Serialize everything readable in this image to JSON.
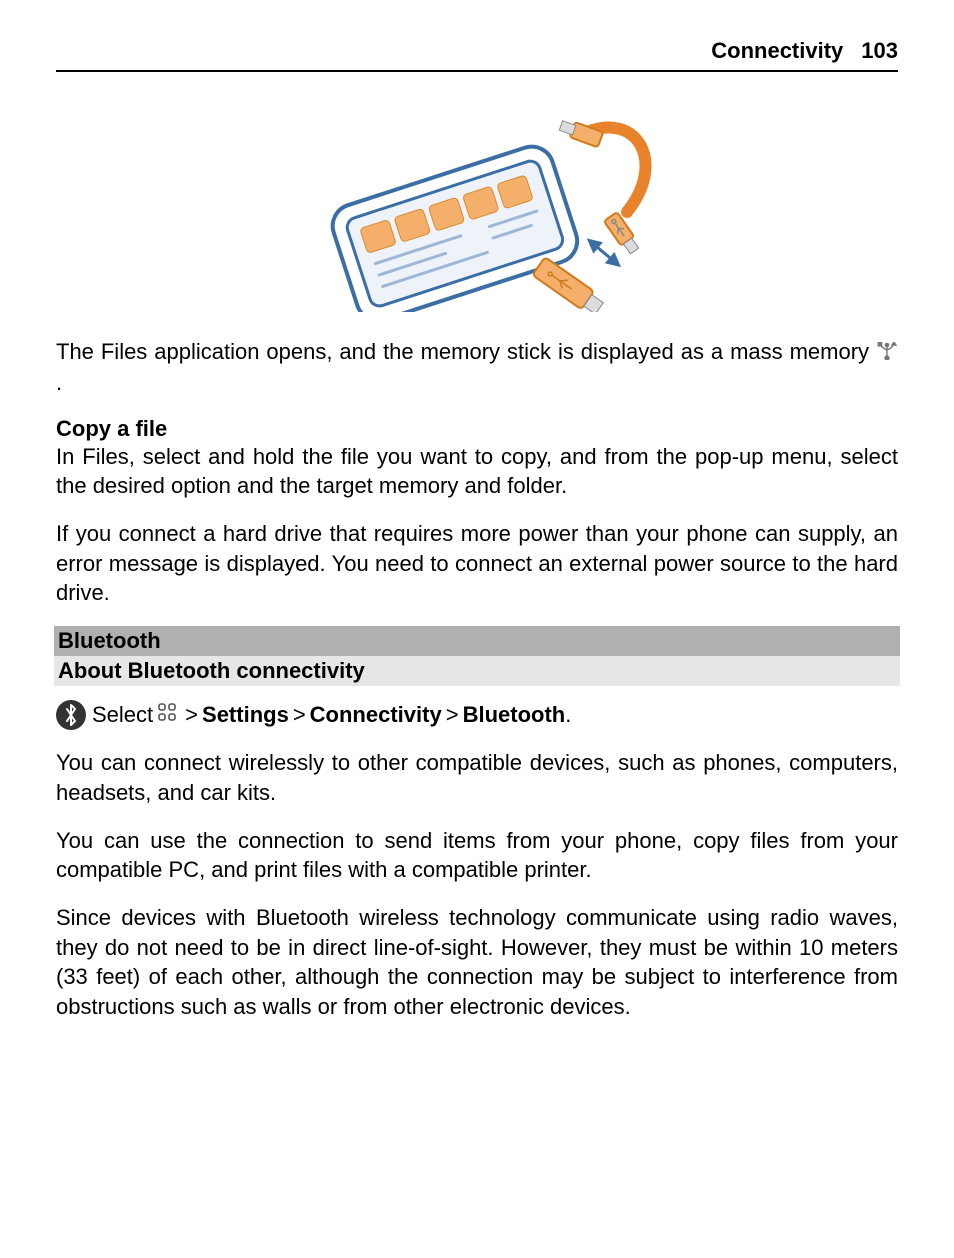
{
  "header": {
    "section": "Connectivity",
    "page": "103"
  },
  "para_files_open_a": "The Files application opens, and the memory stick is displayed as a mass memory ",
  "para_files_open_b": " .",
  "copy_file": {
    "heading": "Copy a file",
    "text": "In Files, select and hold the file you want to copy, and from the pop-up menu, select the desired option and the target memory and folder."
  },
  "hard_drive_note": "If you connect a hard drive that requires more power than your phone can supply, an error message is displayed. You need to connect an external power source to the hard drive.",
  "bluetooth": {
    "section_title": "Bluetooth",
    "about_title": "About Bluetooth connectivity",
    "select_word": "Select",
    "nav": {
      "gt": ">",
      "settings": "Settings",
      "connectivity": "Connectivity",
      "bluetooth": "Bluetooth"
    },
    "period": ".",
    "p1": "You can connect wirelessly to other compatible devices, such as phones, computers, headsets, and car kits.",
    "p2": "You can use the connection to send items from your phone, copy files from your compatible PC, and print files with a compatible printer.",
    "p3": "Since devices with Bluetooth wireless technology communicate using radio waves, they do not need to be in direct line-of-sight. However, they must be within 10 meters (33 feet) of each other, although the connection may be subject to interference from obstructions such as walls or from other electronic devices."
  }
}
